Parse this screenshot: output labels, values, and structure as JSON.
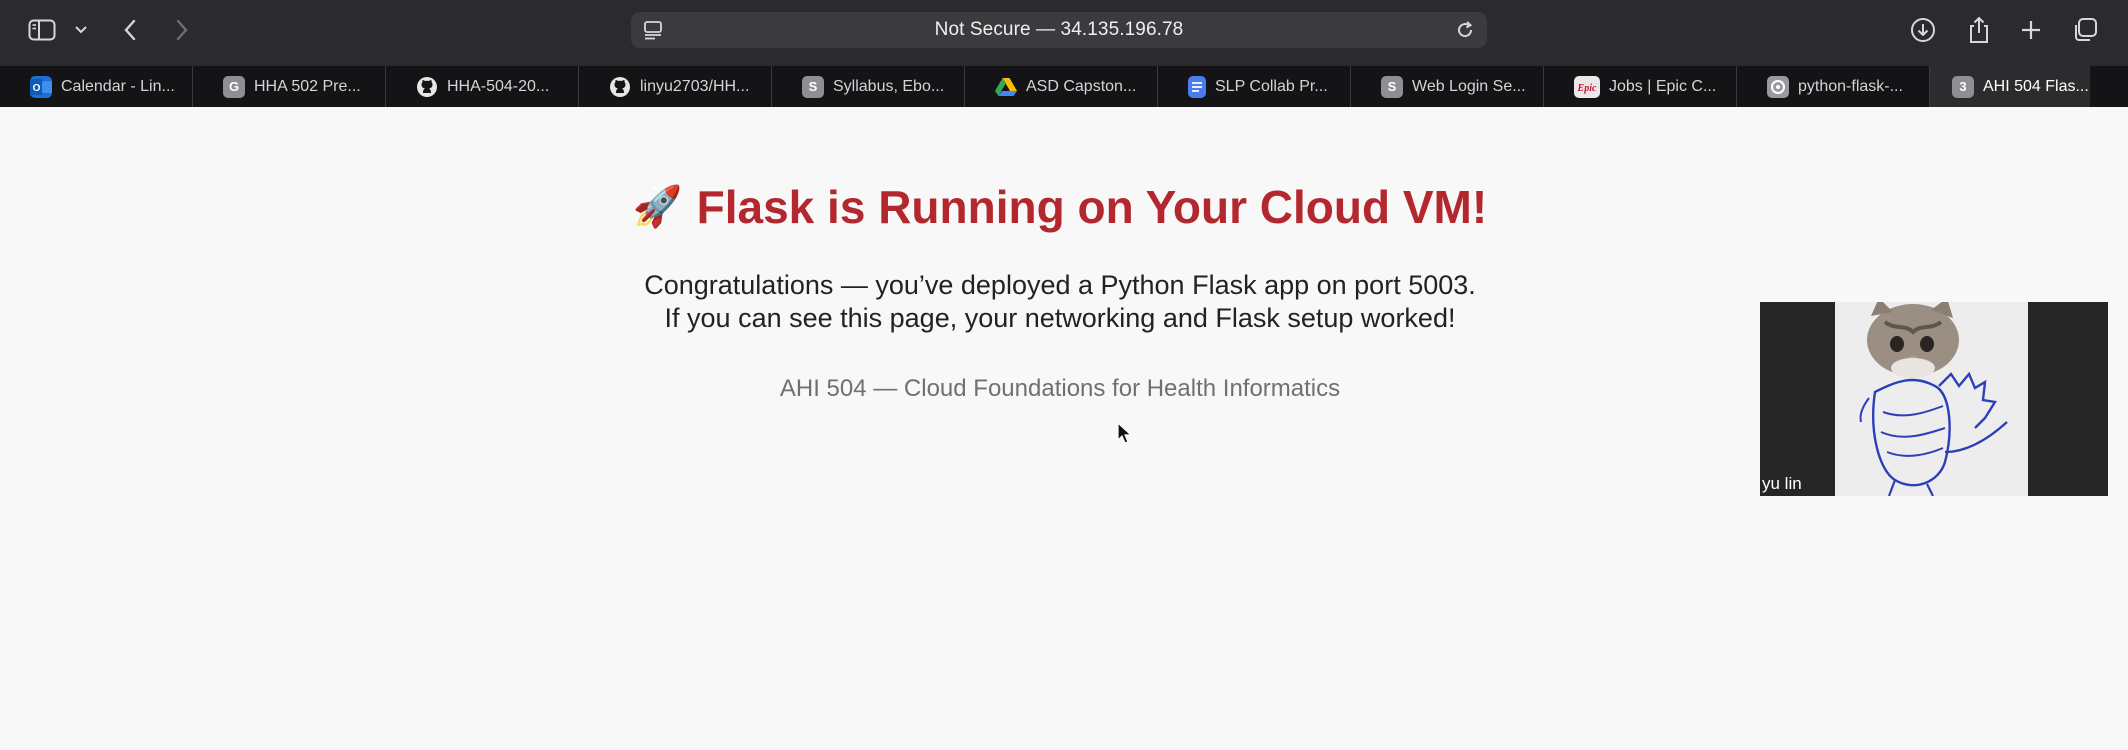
{
  "browser": {
    "address": "Not Secure — 34.135.196.78",
    "tabs": [
      {
        "title": "Calendar - Lin...",
        "icon": "outlook-calendar-icon",
        "color": "#1f6fd1",
        "glyph": "O"
      },
      {
        "title": "HHA 502 Pre...",
        "icon": "generic-site-icon",
        "color": "#8e8e93",
        "glyph": "G"
      },
      {
        "title": "HHA-504-20...",
        "icon": "github-icon",
        "color": "#e6e6e6",
        "glyph": ""
      },
      {
        "title": "linyu2703/HH...",
        "icon": "github-icon",
        "color": "#e6e6e6",
        "glyph": ""
      },
      {
        "title": "Syllabus, Ebo...",
        "icon": "generic-site-icon",
        "color": "#8e8e93",
        "glyph": "S"
      },
      {
        "title": "ASD Capston...",
        "icon": "google-drive-icon",
        "color": "#34a853",
        "glyph": ""
      },
      {
        "title": "SLP Collab Pr...",
        "icon": "google-docs-icon",
        "color": "#4b7bec",
        "glyph": ""
      },
      {
        "title": "Web Login Se...",
        "icon": "generic-site-icon",
        "color": "#8e8e93",
        "glyph": "S"
      },
      {
        "title": "Jobs | Epic C...",
        "icon": "epic-icon",
        "color": "#e9e9ea",
        "glyph": "Epic"
      },
      {
        "title": "python-flask-...",
        "icon": "gear-site-icon",
        "color": "#9a9aa0",
        "glyph": ""
      },
      {
        "title": "AHI 504 Flas...",
        "icon": "generic-site-icon",
        "color": "#8e8e93",
        "glyph": "3"
      }
    ]
  },
  "page": {
    "headline": "Flask is Running on Your Cloud VM!",
    "rocket": "🚀",
    "congrats_line1": "Congratulations — you’ve deployed a Python Flask app on port 5003.",
    "congrats_line2": "If you can see this page, your networking and Flask setup worked!",
    "footer": "AHI 504 — Cloud Foundations for Health Informatics"
  },
  "video": {
    "participant": "yu lin"
  }
}
